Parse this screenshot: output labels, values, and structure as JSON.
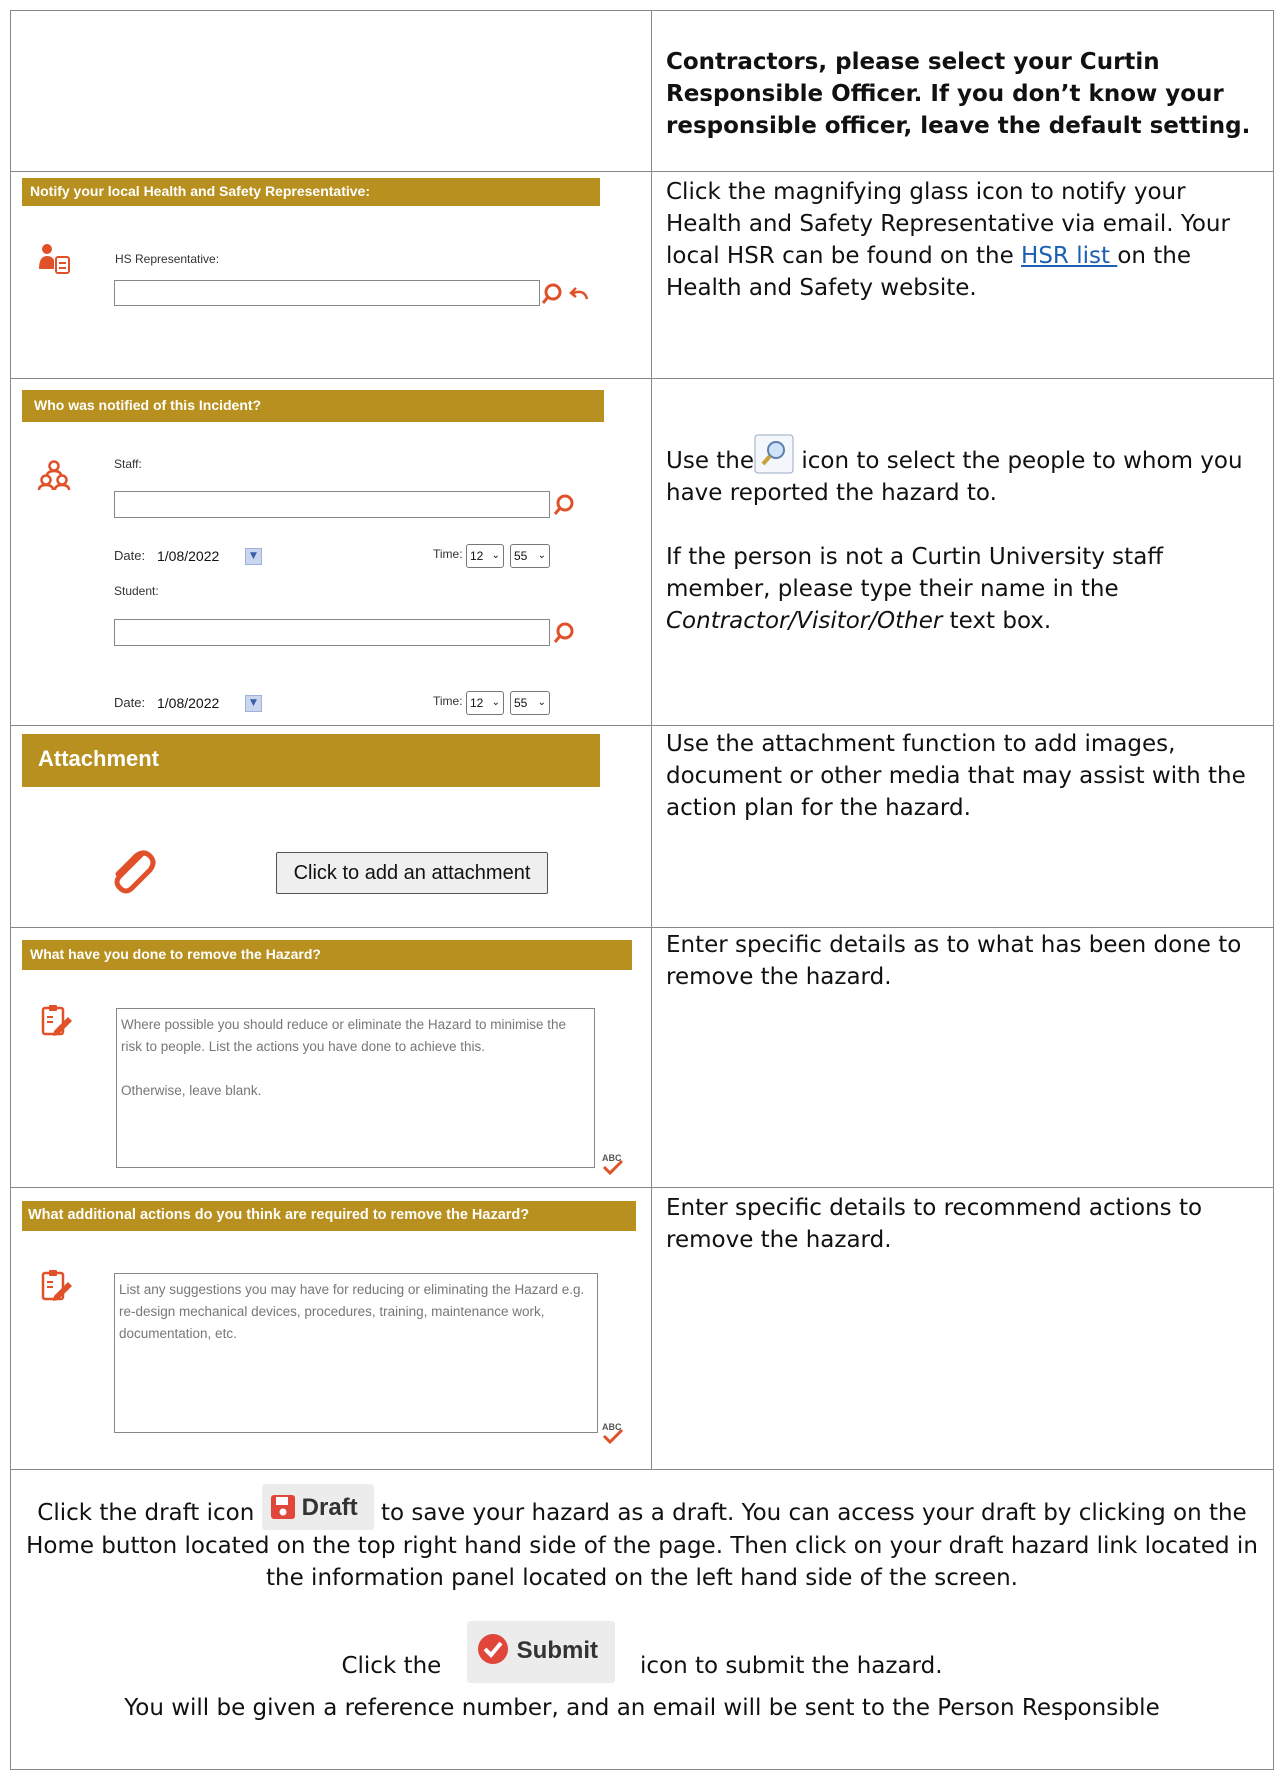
{
  "rows": {
    "contractors": {
      "desc": "Contractors, please select your Curtin Responsible Officer. If you don’t know your responsible officer, leave the default setting."
    },
    "hsr": {
      "header": "Notify your local Health and Safety Representative:",
      "field_label": "HS Representative:",
      "desc_before": "Click the magnifying glass icon to notify your Health and Safety Representative via email. Your local HSR can be found on the ",
      "link": "HSR list ",
      "desc_after": "on the Health and Safety website."
    },
    "notified": {
      "header": "Who was notified of this Incident?",
      "staff_label": "Staff:",
      "student_label": "Student:",
      "date_label": "Date:",
      "date_value": "1/08/2022",
      "time_label": "Time:",
      "hour": "12",
      "minute": "55",
      "desc1_before": "Use the",
      "desc1_after": " icon to select the people to whom you have reported the hazard to.",
      "desc2_before": "If the person is not a Curtin University staff member, please type their name in the ",
      "desc2_italic": "Contractor/Visitor/Other",
      "desc2_after": " text box."
    },
    "attachment": {
      "header": "Attachment",
      "button": "Click to add an attachment",
      "desc": "Use the attachment function to add images, document or other media that may assist with the action plan for the hazard."
    },
    "removed": {
      "header": "What have you done to remove the Hazard?",
      "placeholder": "Where possible you should reduce or eliminate the Hazard to minimise the risk to people. List the actions you have done to achieve this.\n\nOtherwise, leave blank.",
      "spell": "ABC",
      "desc": "Enter specific details as to what has been done to remove the hazard."
    },
    "additional": {
      "header": "What additional actions do you think are required to remove the Hazard?",
      "placeholder": "List any suggestions you may have for reducing or eliminating the Hazard e.g. re-design mechanical devices, procedures, training, maintenance work, documentation, etc.",
      "spell": "ABC",
      "desc": "Enter specific details to recommend actions to remove the hazard."
    }
  },
  "footer": {
    "draft_before": "Click the draft icon ",
    "draft_button": "Draft",
    "draft_after": " to save your hazard as a draft. You can access your draft by clicking on the Home button located on the top right hand side of the page. Then click on your draft hazard link located in the information panel located on the left hand side of the screen.",
    "submit_before": "Click the ",
    "submit_button": "Submit",
    "submit_after": " icon to submit the hazard.",
    "last_line": "You will be given a reference number, and an email will be sent to the Person Responsible"
  },
  "colors": {
    "header_bg": "#b8901f",
    "icon": "#e0512a",
    "link": "#1a5fb4"
  }
}
